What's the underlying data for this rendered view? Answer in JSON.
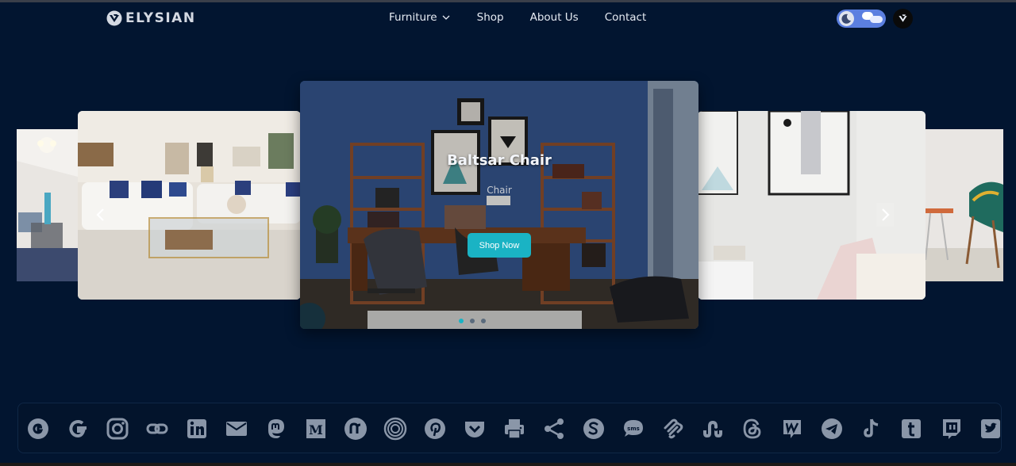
{
  "brand": {
    "name": "ELYSIAN"
  },
  "nav": {
    "items": [
      {
        "label": "Furniture",
        "has_dropdown": true
      },
      {
        "label": "Shop"
      },
      {
        "label": "About Us"
      },
      {
        "label": "Contact"
      }
    ]
  },
  "hero": {
    "title": "Baltsar Chair",
    "subtitle": "Chair",
    "button_label": "Shop Now",
    "slide_count": 3,
    "active_slide": 1
  },
  "share_icons": [
    "google-icon",
    "google-alt-icon",
    "instagram-icon",
    "link-icon",
    "linkedin-icon",
    "email-icon",
    "mastodon-icon",
    "medium-icon",
    "nextdoor-icon",
    "ello-icon",
    "pinterest-icon",
    "pocket-icon",
    "print-icon",
    "share-icon",
    "skype-icon",
    "sms-icon",
    "squarespace-icon",
    "stumbleupon-icon",
    "threads-icon",
    "wattpad-icon",
    "telegram-icon",
    "tiktok-icon",
    "tumblr-icon",
    "twitch-icon",
    "twitter-icon"
  ],
  "colors": {
    "background": "#021530",
    "accent": "#1ab3c4",
    "icon": "#8a96a8"
  }
}
